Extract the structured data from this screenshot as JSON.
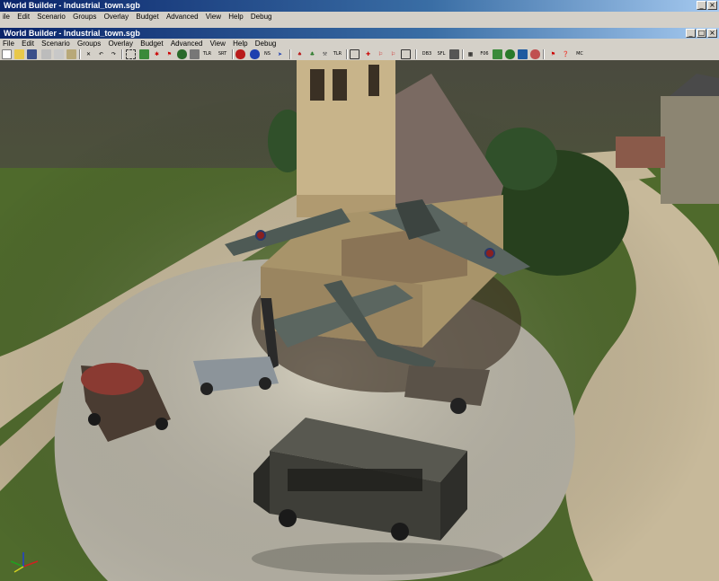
{
  "window": {
    "title_back": "World Builder - Industrial_town.sgb",
    "title_front": "World Builder - Industrial_town.sgb"
  },
  "menu_back": [
    "ile",
    "Edit",
    "Scenario",
    "Groups",
    "Overlay",
    "Budget",
    "Advanced",
    "View",
    "Help",
    "Debug"
  ],
  "menu_front": [
    "File",
    "Edit",
    "Scenario",
    "Groups",
    "Overlay",
    "Budget",
    "Advanced",
    "View",
    "Help",
    "Debug"
  ],
  "toolbar": {
    "tlr_label": "TLR",
    "srt_label": "SRT",
    "ns_label": "NS",
    "tlr2_label": "TLR",
    "db3_label": "DB3",
    "sfl_label": "SFL",
    "f06_label": "F06",
    "mc_label": "MC"
  },
  "colors": {
    "title_start": "#0a246a",
    "chrome": "#d4d0c8",
    "grass": "#4f6a2c",
    "gravel": "#b9b5a8",
    "path": "#c7b99a"
  },
  "viewport": {
    "scene": "3D terrain view: damaged church, crashed aircraft, wrecked vehicles and a bus on a gravel plaza",
    "axis_labels": [
      "x",
      "y",
      "z"
    ]
  }
}
